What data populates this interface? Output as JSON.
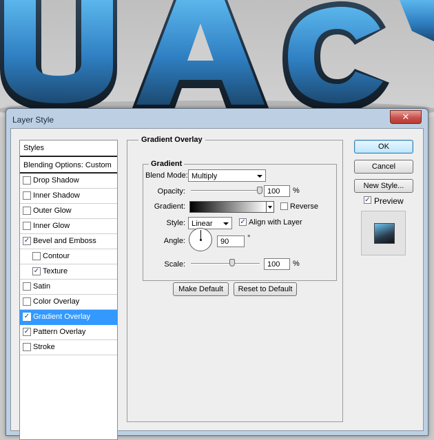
{
  "background_art": {
    "letters": "UAC",
    "color": "#2f7fc2"
  },
  "dialog": {
    "title": "Layer Style",
    "close_label": "✕"
  },
  "styles_list": {
    "header": "Styles",
    "blending": "Blending Options: Custom",
    "items": [
      {
        "label": "Drop Shadow",
        "checked": false,
        "indent": false,
        "selected": false
      },
      {
        "label": "Inner Shadow",
        "checked": false,
        "indent": false,
        "selected": false
      },
      {
        "label": "Outer Glow",
        "checked": false,
        "indent": false,
        "selected": false
      },
      {
        "label": "Inner Glow",
        "checked": false,
        "indent": false,
        "selected": false
      },
      {
        "label": "Bevel and Emboss",
        "checked": true,
        "indent": false,
        "selected": false
      },
      {
        "label": "Contour",
        "checked": false,
        "indent": true,
        "selected": false
      },
      {
        "label": "Texture",
        "checked": true,
        "indent": true,
        "selected": false
      },
      {
        "label": "Satin",
        "checked": false,
        "indent": false,
        "selected": false
      },
      {
        "label": "Color Overlay",
        "checked": false,
        "indent": false,
        "selected": false
      },
      {
        "label": "Gradient Overlay",
        "checked": true,
        "indent": false,
        "selected": true
      },
      {
        "label": "Pattern Overlay",
        "checked": true,
        "indent": false,
        "selected": false
      },
      {
        "label": "Stroke",
        "checked": false,
        "indent": false,
        "selected": false
      }
    ]
  },
  "gradient_overlay": {
    "section_title": "Gradient Overlay",
    "group_title": "Gradient",
    "blend_mode_label": "Blend Mode:",
    "blend_mode_value": "Multiply",
    "opacity_label": "Opacity:",
    "opacity_value": "100",
    "opacity_percent": 100,
    "gradient_label": "Gradient:",
    "reverse_label": "Reverse",
    "reverse_checked": false,
    "style_label": "Style:",
    "style_value": "Linear",
    "align_label": "Align with Layer",
    "align_checked": true,
    "angle_label": "Angle:",
    "angle_value": "90",
    "angle_unit": "°",
    "scale_label": "Scale:",
    "scale_value": "100",
    "scale_percent": 100,
    "percent_unit": "%",
    "make_default_label": "Make Default",
    "reset_default_label": "Reset to Default"
  },
  "right_panel": {
    "ok_label": "OK",
    "cancel_label": "Cancel",
    "new_style_label": "New Style...",
    "preview_label": "Preview",
    "preview_checked": true
  }
}
